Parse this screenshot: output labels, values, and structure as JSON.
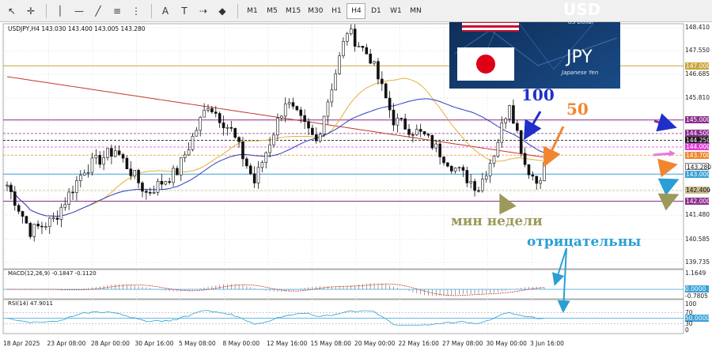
{
  "toolbar": {
    "tools": [
      {
        "name": "cursor-icon",
        "glyph": "↖"
      },
      {
        "name": "crosshair-icon",
        "glyph": "✛"
      },
      {
        "name": "vertical-line-icon",
        "glyph": "│"
      },
      {
        "name": "horizontal-line-icon",
        "glyph": "—"
      },
      {
        "name": "trendline-icon",
        "glyph": "╱"
      },
      {
        "name": "channel-icon",
        "glyph": "≡"
      },
      {
        "name": "fibonacci-icon",
        "glyph": "⋮"
      },
      {
        "name": "text-icon",
        "glyph": "A"
      },
      {
        "name": "label-icon",
        "glyph": "T"
      },
      {
        "name": "arrows-icon",
        "glyph": "⇢"
      },
      {
        "name": "shapes-icon",
        "glyph": "◆"
      }
    ],
    "timeframes": [
      "M1",
      "M5",
      "M15",
      "M30",
      "H1",
      "H4",
      "D1",
      "W1",
      "MN"
    ],
    "active_timeframe": "H4"
  },
  "chart": {
    "symbol_header": "USDJPY,H4  143.030 143.400 143.005 143.280",
    "flag_top_label": "USD",
    "flag_top_sub": "US Dollar",
    "flag_bottom_label": "JPY",
    "flag_bottom_sub": "Japanese Yen",
    "price_axis": [
      "148.410",
      "147.550",
      "146.685",
      "145.810",
      "144.945",
      "144.080",
      "143.215",
      "142.350",
      "141.480",
      "140.585",
      "139.735"
    ],
    "levels": [
      {
        "label": "147.000",
        "color": "#c9a43a"
      },
      {
        "label": "145.000",
        "color": "#8b2f8b"
      },
      {
        "label": "144.500",
        "color": "#8b2f8b"
      },
      {
        "label": "144.250",
        "color": "#1a1a1a"
      },
      {
        "label": "144.000",
        "color": "#e23bd9"
      },
      {
        "label": "143.700",
        "color": "#f0862f"
      },
      {
        "label": "143.280",
        "color": "#ffffff"
      },
      {
        "label": "143.000",
        "color": "#3aa0d8"
      },
      {
        "label": "142.400",
        "color": "#c9b98c"
      },
      {
        "label": "142.000",
        "color": "#8b2f8b"
      }
    ],
    "time_axis": [
      "18 Apr 2025",
      "23 Apr 08:00",
      "28 Apr 00:00",
      "30 Apr 16:00",
      "5 May 08:00",
      "8 May 00:00",
      "12 May 16:00",
      "15 May 08:00",
      "20 May 00:00",
      "22 May 16:00",
      "27 May 08:00",
      "30 May 00:00",
      "3 Jun 16:00"
    ],
    "macd": {
      "header": "MACD(12,26,9) -0.1847 -0.1120",
      "scale": [
        "1.1649",
        "0.0000",
        "-0.7805"
      ]
    },
    "rsi": {
      "header": "RSI(14) 47.9011",
      "scale": [
        "100",
        "70",
        "50.0000",
        "30",
        "0"
      ]
    },
    "annotations": {
      "ma100": "100",
      "ma50": "50",
      "week_low": "мин недели",
      "negative": "отрицательны"
    },
    "colors": {
      "ma50": "#e3b03c",
      "ma100": "#2b3dbf",
      "ma200": "#c0392b",
      "annot_blue": "#2a9fd6",
      "annot_orange": "#f0862f",
      "annot_olive": "#9c9a5a",
      "annot_navy": "#1f2fc9"
    }
  }
}
